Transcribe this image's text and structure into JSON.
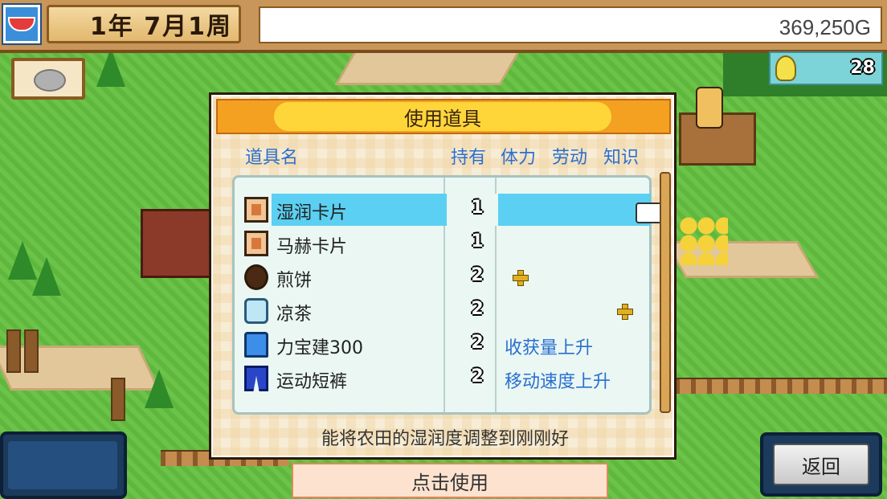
{
  "header": {
    "date": "1年 7月1周",
    "money": "369,250G",
    "idea_points": "28"
  },
  "dialog": {
    "title": "使用道具",
    "columns": {
      "name": "道具名",
      "owned": "持有",
      "stamina": "体力",
      "labor": "劳动",
      "knowledge": "知识"
    },
    "items": [
      {
        "icon": "card-icon",
        "name": "湿润卡片",
        "qty": "1",
        "effect": "",
        "selected": true
      },
      {
        "icon": "card-icon",
        "name": "马赫卡片",
        "qty": "1",
        "effect": ""
      },
      {
        "icon": "pancake-icon",
        "name": "煎饼",
        "qty": "2",
        "effect": "",
        "plus_stat": "stamina"
      },
      {
        "icon": "tea-icon",
        "name": "凉茶",
        "qty": "2",
        "effect": "",
        "plus_stat": "knowledge"
      },
      {
        "icon": "bottle-icon",
        "name": "力宝建300",
        "qty": "2",
        "effect": "收获量上升"
      },
      {
        "icon": "shorts-icon",
        "name": "运动短裤",
        "qty": "2",
        "effect": "移动速度上升"
      }
    ],
    "description": "能将农田的湿润度调整到刚刚好"
  },
  "buttons": {
    "use": "点击使用",
    "back": "返回"
  },
  "colors": {
    "grass": "#63c03f",
    "title_orange": "#f4a020",
    "selected_row": "#5bd0f2",
    "column_header": "#2a6fd0"
  }
}
